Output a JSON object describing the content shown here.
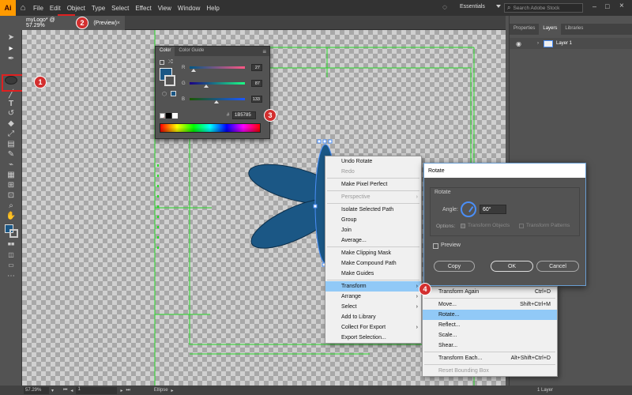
{
  "app": {
    "logo_text": "Ai",
    "menu": [
      "File",
      "Edit",
      "Object",
      "Type",
      "Select",
      "Effect",
      "View",
      "Window",
      "Help"
    ],
    "workspace": "Essentials",
    "search_placeholder": "Search Adobe Stock"
  },
  "document_tab": {
    "title": "myLogo* @ 57.29%",
    "title_suffix": "(Preview)",
    "close": "×"
  },
  "right_panel": {
    "tabs": [
      "Properties",
      "Layers",
      "Libraries"
    ],
    "active_tab": "Layers",
    "layer_name": "Layer 1"
  },
  "color_panel": {
    "tabs": [
      "Color",
      "Color Guide"
    ],
    "active_tab": "Color",
    "r_label": "R",
    "r_value": "27",
    "g_label": "G",
    "g_value": "87",
    "b_label": "B",
    "b_value": "133",
    "hex_label": "#",
    "hex_value": "1B5785",
    "fill_color": "#1B5785"
  },
  "context_menu": {
    "items": [
      {
        "label": "Undo Rotate",
        "disabled": false,
        "sub": false
      },
      {
        "label": "Redo",
        "disabled": true,
        "sub": false
      },
      {
        "sep": true
      },
      {
        "label": "Make Pixel Perfect",
        "disabled": false,
        "sub": false
      },
      {
        "sep": true
      },
      {
        "label": "Perspective",
        "disabled": true,
        "sub": true
      },
      {
        "sep": true
      },
      {
        "label": "Isolate Selected Path",
        "disabled": false,
        "sub": false
      },
      {
        "label": "Group",
        "disabled": false,
        "sub": false
      },
      {
        "label": "Join",
        "disabled": false,
        "sub": false
      },
      {
        "label": "Average...",
        "disabled": false,
        "sub": false
      },
      {
        "sep": true
      },
      {
        "label": "Make Clipping Mask",
        "disabled": false,
        "sub": false
      },
      {
        "label": "Make Compound Path",
        "disabled": false,
        "sub": false
      },
      {
        "label": "Make Guides",
        "disabled": false,
        "sub": false
      },
      {
        "sep": true
      },
      {
        "label": "Transform",
        "disabled": false,
        "sub": true,
        "highlight": true
      },
      {
        "label": "Arrange",
        "disabled": false,
        "sub": true
      },
      {
        "label": "Select",
        "disabled": false,
        "sub": true
      },
      {
        "label": "Add to Library",
        "disabled": false,
        "sub": false
      },
      {
        "label": "Collect For Export",
        "disabled": false,
        "sub": true
      },
      {
        "label": "Export Selection...",
        "disabled": false,
        "sub": false
      }
    ]
  },
  "transform_submenu": {
    "items": [
      {
        "label": "Transform Again",
        "shortcut": "Ctrl+D"
      },
      {
        "sep": true
      },
      {
        "label": "Move...",
        "shortcut": "Shift+Ctrl+M"
      },
      {
        "label": "Rotate...",
        "shortcut": "",
        "highlight": true
      },
      {
        "label": "Reflect...",
        "shortcut": ""
      },
      {
        "label": "Scale...",
        "shortcut": ""
      },
      {
        "label": "Shear...",
        "shortcut": ""
      },
      {
        "sep": true
      },
      {
        "label": "Transform Each...",
        "shortcut": "Alt+Shift+Ctrl+D"
      },
      {
        "sep": true
      },
      {
        "label": "Reset Bounding Box",
        "shortcut": "",
        "disabled": true
      }
    ]
  },
  "rotate_dialog": {
    "title": "Rotate",
    "section": "Rotate",
    "angle_label": "Angle:",
    "angle_value": "60°",
    "options_label": "Options:",
    "opt_objects": "Transform Objects",
    "opt_patterns": "Transform Patterns",
    "preview_label": "Preview",
    "copy": "Copy",
    "ok": "OK",
    "cancel": "Cancel"
  },
  "status": {
    "zoom": "57.29%",
    "artboard": "1",
    "selection": "Ellipse",
    "layers": "1 Layer"
  },
  "badges": [
    "1",
    "2",
    "3",
    "4"
  ],
  "colors": {
    "guide": "#27d827",
    "shape_fill": "#1B5785",
    "highlight": "#91c9f7",
    "badge": "#d32f2f"
  }
}
